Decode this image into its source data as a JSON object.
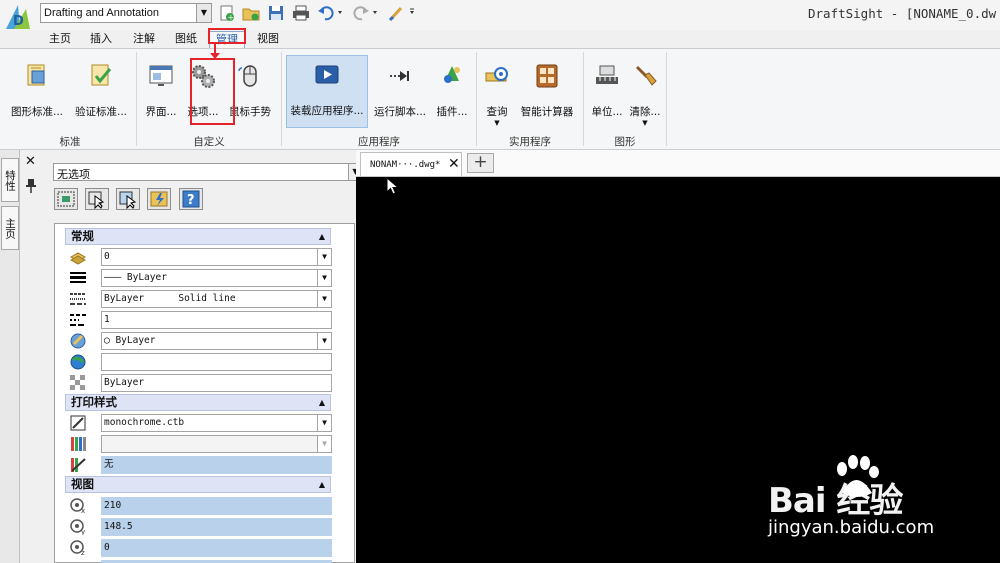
{
  "titlebar": {
    "workspace": "Drafting and Annotation",
    "app_title": "DraftSight - [NONAME_0.dw"
  },
  "ribbon_tabs": [
    "主页",
    "插入",
    "注解",
    "图纸",
    "管理",
    "视图"
  ],
  "ribbon": {
    "buttons": {
      "drawing_standards": "图形标准...",
      "check_standards": "验证标准...",
      "interface": "界面...",
      "options": "选项...",
      "mouse_gestures": "鼠标手势",
      "load_application": "装载应用程序...",
      "run_script": "运行脚本...",
      "plugins": "插件...",
      "query": "查询",
      "smart_calculator": "智能计算器",
      "units": "单位...",
      "clean": "清除..."
    },
    "groups": {
      "standards": "标准",
      "customize": "自定义",
      "applications": "应用程序",
      "utilities": "实用程序",
      "drawing": "图形"
    }
  },
  "side_tabs": [
    "特性",
    "主页"
  ],
  "properties": {
    "selection": "无选项",
    "sections": {
      "general": "常规",
      "plot_style": "打印样式",
      "view": "视图"
    },
    "general_rows": [
      {
        "icon": "layer-icon",
        "value": "0",
        "dropdown": true
      },
      {
        "icon": "color-icon",
        "value": "——— ByLayer",
        "dropdown": true
      },
      {
        "icon": "linetype-icon",
        "value": "ByLayer      Solid line",
        "dropdown": true
      },
      {
        "icon": "linetype-scale-icon",
        "value": "1",
        "dropdown": false
      },
      {
        "icon": "lineweight-icon",
        "value": "◯ ByLayer",
        "dropdown": true
      },
      {
        "icon": "hyperlink-icon",
        "value": "",
        "dropdown": false
      },
      {
        "icon": "transparency-icon",
        "value": "ByLayer",
        "dropdown": false
      }
    ],
    "plot_rows": [
      {
        "icon": "plot-style-icon",
        "value": "monochrome.ctb",
        "dropdown": true
      },
      {
        "icon": "plot-table-icon",
        "value": "",
        "dropdown": true
      },
      {
        "icon": "plot-attach-icon",
        "value": "无",
        "dropdown": false
      }
    ],
    "view_rows": [
      {
        "icon": "center-x-icon",
        "value": "210"
      },
      {
        "icon": "center-y-icon",
        "value": "148.5"
      },
      {
        "icon": "center-z-icon",
        "value": "0"
      }
    ]
  },
  "document": {
    "tab_label": "NONAM···.dwg*"
  },
  "watermark": {
    "brand": "Bai 经验",
    "url": "jingyan.baidu.com"
  },
  "colors": {
    "accent": "#1e5aa8",
    "highlight_red": "#e5232b",
    "selected_field": "#b9d1ea",
    "canvas": "#000000"
  }
}
